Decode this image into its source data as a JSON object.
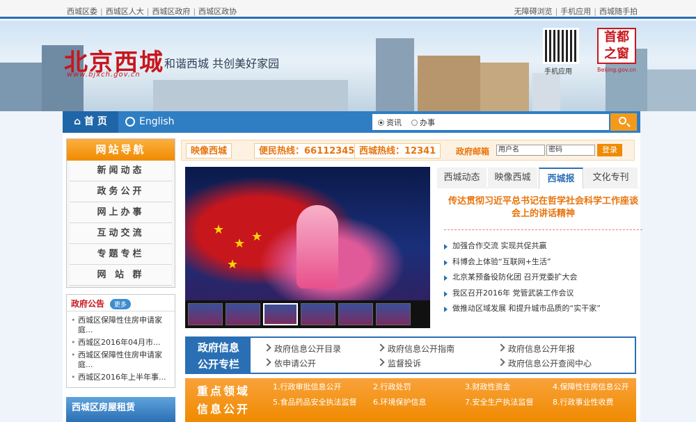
{
  "topbar": {
    "left_links": [
      "西城区委",
      "西城区人大",
      "西城区政府",
      "西城区政协"
    ],
    "right_links": [
      "无障碍浏览",
      "手机应用",
      "西城随手拍"
    ]
  },
  "banner": {
    "logo": "北京西城",
    "logo_url": "www.bjxch.gov.cn",
    "slogan": "和谐西城  共创美好家园",
    "qr_label": "手机应用",
    "capital_text": "首都之窗",
    "capital_label": "Beijing.gov.cn"
  },
  "nav": {
    "home": "首 页",
    "english": "English",
    "search_options": [
      "资讯",
      "办事"
    ],
    "search_selected": "资讯",
    "search_placeholder": ""
  },
  "hotline": {
    "tag1": "映像西城",
    "tag2": "便民热线：66112345",
    "tag3": "西城热线：12341",
    "mail_label": "政府邮箱",
    "username_placeholder": "用户名",
    "password_placeholder": "密码",
    "login": "登录"
  },
  "sidenav": {
    "title": "网站导航",
    "items": [
      "新闻动态",
      "政务公开",
      "网上办事",
      "互动交流",
      "专题专栏",
      "网 站 群"
    ]
  },
  "notice": {
    "title": "政府公告",
    "more": "更多",
    "items": [
      "西城区保障性住房申请家庭...",
      "西城区2016年04月市...",
      "西城区保障性住房申请家庭...",
      "西城区2016年上半年事..."
    ]
  },
  "rental": {
    "text": "西城区房屋租赁"
  },
  "tabs": [
    "西城动态",
    "映像西城",
    "西城报",
    "文化专刊"
  ],
  "active_tab": "西城报",
  "headline": "传达贯彻习近平总书记在哲学社会科学工作座谈会上的讲话精神",
  "news": [
    "加强合作交流 实现共促共赢",
    "科博会上体验“互联网+生活”",
    "北京某预备役防化团 召开党委扩大会",
    "我区召开2016年 党管武装工作会议",
    "做推动区域发展 和提升城市品质的“实干家”"
  ],
  "govinfo": {
    "label_line1": "政府信息",
    "label_line2": "公开专栏",
    "links": [
      "政府信息公开目录",
      "政府信息公开指南",
      "政府信息公开年报",
      "依申请公开",
      "监督投诉",
      "政府信息公开查阅中心"
    ]
  },
  "keyarea": {
    "label_line1": "重点领域",
    "label_line2": "信息公开",
    "links": [
      "1.行政审批信息公开",
      "2.行政处罚",
      "3.财政性资金",
      "4.保障性住房信息公开",
      "5.食品药品安全执法监督",
      "6.环境保护信息",
      "7.安全生产执法监督",
      "8.行政事业性收费"
    ]
  }
}
